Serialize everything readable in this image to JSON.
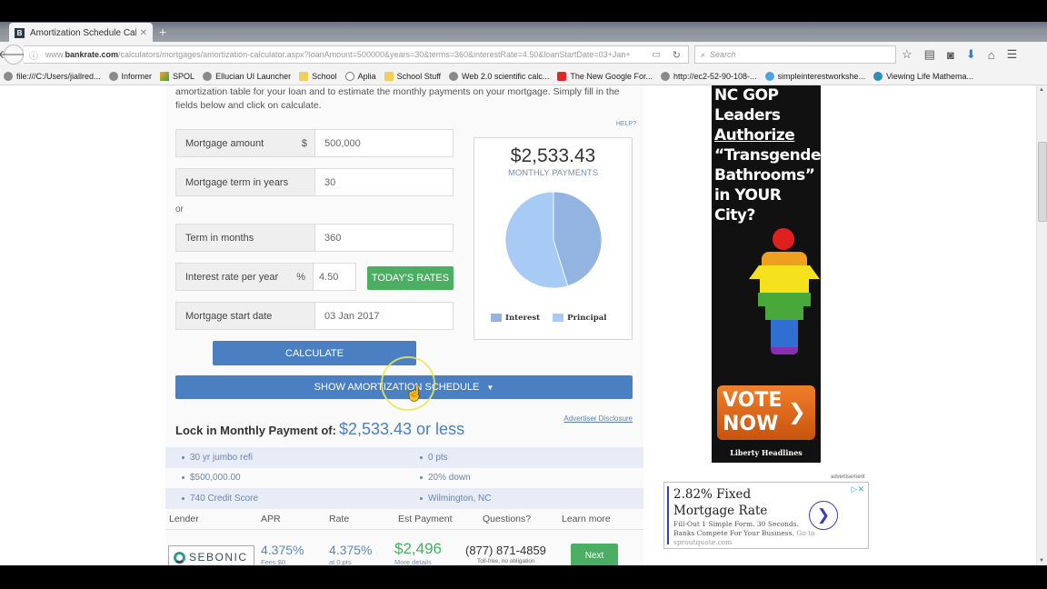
{
  "browser": {
    "tab_title": "Amortization Schedule Cal...",
    "tab_favicon": "B",
    "url_prefix": "www.",
    "url_domain": "bankrate.com",
    "url_path": "/calculators/mortgages/amortization-calculator.aspx?loanAmount=500000&years=30&terms=360&interestRate=4.50&loanStartDate=03+Jan+",
    "search_placeholder": "Search",
    "bookmarks": [
      {
        "label": "file:///C:/Users/jiallred...",
        "icon": "globe-icon"
      },
      {
        "label": "Informer",
        "icon": "globe-icon"
      },
      {
        "label": "SPOL",
        "icon": "spol-icon"
      },
      {
        "label": "Ellucian UI Launcher",
        "icon": "globe-icon"
      },
      {
        "label": "School",
        "icon": "folder-icon"
      },
      {
        "label": "Aplia",
        "icon": "aplia-icon"
      },
      {
        "label": "School Stuff",
        "icon": "folder-icon"
      },
      {
        "label": "Web 2.0 scientific calc...",
        "icon": "globe-icon"
      },
      {
        "label": "The New Google For...",
        "icon": "youtube-icon"
      },
      {
        "label": "http://ec2-52-90-108-...",
        "icon": "globe-icon"
      },
      {
        "label": "simpleinterestworkshe...",
        "icon": "weebly-icon"
      },
      {
        "label": "Viewing Life Mathema...",
        "icon": "site-icon"
      }
    ]
  },
  "calculator": {
    "intro": "amortization table for your loan and to estimate the monthly payments on your mortgage. Simply fill in the fields below and click on calculate.",
    "help_label": "HELP?",
    "fields": {
      "amount": {
        "label": "Mortgage amount",
        "unit": "$",
        "value": "500,000"
      },
      "years": {
        "label": "Mortgage term in years",
        "value": "30"
      },
      "or_label": "or",
      "months": {
        "label": "Term in months",
        "value": "360"
      },
      "rate": {
        "label": "Interest rate per year",
        "unit": "%",
        "value": "4.50"
      },
      "start": {
        "label": "Mortgage start date",
        "value": "03 Jan 2017"
      }
    },
    "todays_rates_label": "TODAY'S RATES",
    "calculate_label": "CALCULATE",
    "show_schedule_label": "SHOW AMORTIZATION SCHEDULE",
    "result": {
      "monthly_payment": "$2,533.43",
      "monthly_label": "MONTHLY PAYMENTS"
    }
  },
  "chart_data": {
    "type": "pie",
    "title": "$2,533.43",
    "subtitle": "MONTHLY PAYMENTS",
    "categories": [
      "Interest",
      "Principal"
    ],
    "values": [
      45.2,
      54.8
    ],
    "colors": [
      "#93b4e0",
      "#a8cbf5"
    ],
    "legend": "bottom"
  },
  "offers": {
    "advertiser_disclosure": "Advertiser Disclosure",
    "lock_label": "Lock in Monthly Payment of:",
    "lock_value": "$2,533.43 or less",
    "criteria": [
      [
        "30 yr jumbo refi",
        "0 pts"
      ],
      [
        "$500,000.00",
        "20% down"
      ],
      [
        "740 Credit Score",
        "Wilmington, NC"
      ]
    ],
    "columns": [
      "Lender",
      "APR",
      "Rate",
      "Est Payment",
      "Questions?",
      "Learn more"
    ],
    "rows": [
      {
        "lender": "SEBONIC",
        "apr": "4.375%",
        "apr_sub": "Fees $0",
        "rate": "4.375%",
        "rate_sub": "at 0 pts",
        "payment": "$2,496",
        "payment_sub": "More details",
        "phone": "(877) 871-4859",
        "phone_sub": "Toll-free, no obligation",
        "action": "Next"
      }
    ]
  },
  "ads": {
    "sky": {
      "lines": [
        "NC GOP",
        "Leaders",
        "Authorize",
        "“Transgender",
        "Bathrooms”",
        "in YOUR",
        "City?"
      ],
      "cta_line1": "VOTE",
      "cta_line2": "NOW",
      "brand": "Liberty Headlines"
    },
    "label": "advertisement",
    "text_ad": {
      "title": "2.82% Fixed Mortgage Rate",
      "body": "Fill-Out 1 Simple Form. 30 Seconds. Banks Compete For Your Business.",
      "link": "Go to sproutquote.com"
    }
  }
}
